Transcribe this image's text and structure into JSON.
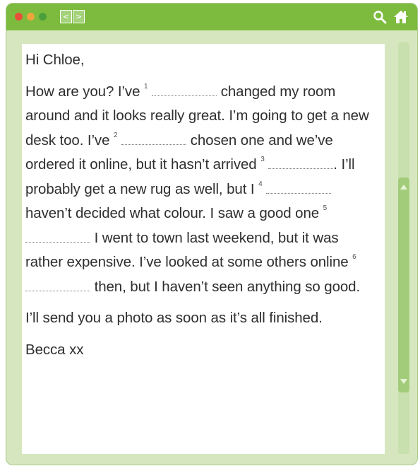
{
  "nav": {
    "back_glyph": "<",
    "forward_glyph": ">"
  },
  "icons": {
    "search": "search-icon",
    "home": "home-icon"
  },
  "colors": {
    "titlebar": "#7dbb3e",
    "window_bg": "#d6e7bf",
    "scroll_thumb": "#a3cc7a"
  },
  "letter": {
    "greeting": "Hi Chloe,",
    "p1_a": "How are you? I’ve",
    "n1": "1",
    "p1_b": "changed my room around and it looks really great. I’m going to get a new desk too. I’ve",
    "n2": "2",
    "p1_c": "chosen one and we’ve ordered it online, but it hasn’t arrived",
    "n3": "3",
    "p1_d": ". I’ll probably get a new rug as well, but I",
    "n4": "4",
    "p1_e": "haven’t decided what colour. I saw a good one",
    "n5": "5",
    "p1_f": "I went to town last weekend, but it was rather expensive. I’ve looked at some others online",
    "n6": "6",
    "p1_g": "then, but I haven’t seen anything so good.",
    "p2": "I’ll send you a photo as soon as it’s all finished.",
    "signoff": "Becca xx"
  }
}
